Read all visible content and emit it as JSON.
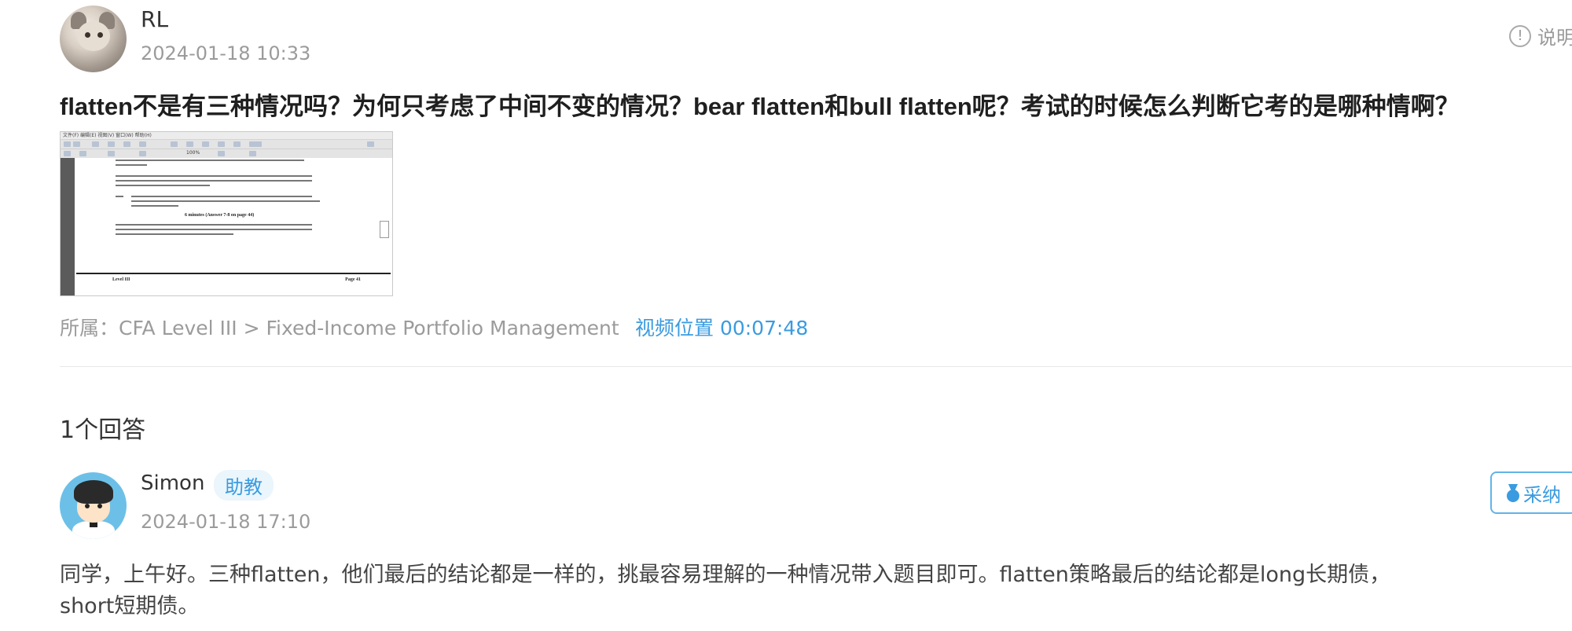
{
  "question": {
    "author": "RL",
    "date": "2024-01-18 10:33",
    "explain_label": "说明",
    "title": "flatten不是有三种情况吗？为何只考虑了中间不变的情况？bear flatten和bull flatten呢？考试的时候怎么判断它考的是哪种情啊？",
    "belongs": "所属：CFA Level III > Fixed-Income Portfolio Management",
    "video_position": "视频位置 00:07:48",
    "thumbnail": {
      "menu": "文件(F)  编辑(E)  视图(V)  窗口(W)  帮助(H)",
      "zoom": "100%",
      "page_heading": "6 minutes (Answer 7-8 on page 44)",
      "footer_left": "Level III",
      "footer_right": "Page 41"
    }
  },
  "answers_count": "1个回答",
  "answer": {
    "author": "Simon",
    "badge": "助教",
    "date": "2024-01-18 17:10",
    "adopt_label": "采纳",
    "text": "同学，上午好。三种flatten，他们最后的结论都是一样的，挑最容易理解的一种情况带入题目即可。flatten策略最后的结论都是long长期债，short短期债。"
  },
  "icons": {
    "info": "info-icon",
    "medal": "medal-icon"
  },
  "colors": {
    "accent": "#3a9be0",
    "muted": "#9b9b9b",
    "badge_bg": "#eaf5fc"
  }
}
